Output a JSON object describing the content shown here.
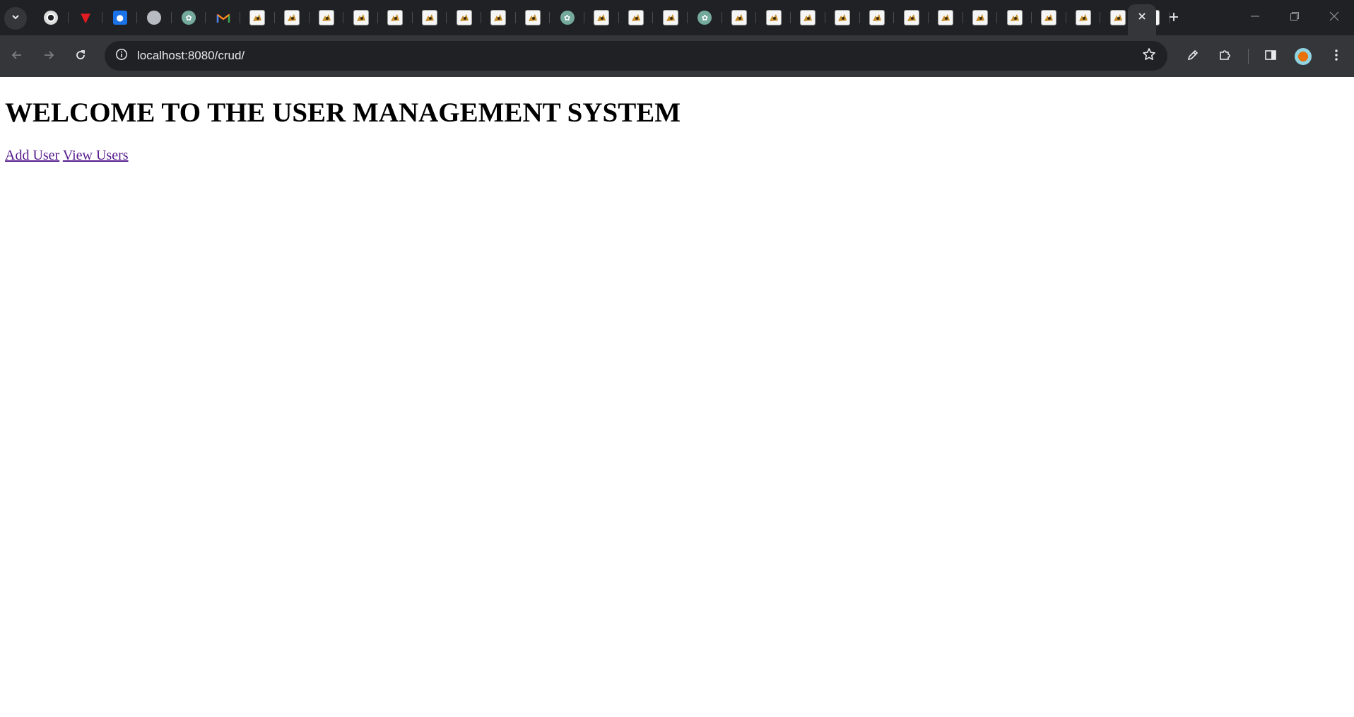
{
  "browser": {
    "tabs": [
      {
        "icon": "chrome-icon"
      },
      {
        "icon": "v-logo-icon"
      },
      {
        "icon": "contacts-icon"
      },
      {
        "icon": "globe-icon"
      },
      {
        "icon": "chatgpt-icon"
      },
      {
        "icon": "gmail-icon"
      },
      {
        "icon": "cat-sticker-icon"
      },
      {
        "icon": "cat-sticker-icon"
      },
      {
        "icon": "cat-sticker-icon"
      },
      {
        "icon": "cat-sticker-icon"
      },
      {
        "icon": "cat-sticker-icon"
      },
      {
        "icon": "cat-sticker-icon"
      },
      {
        "icon": "cat-sticker-icon"
      },
      {
        "icon": "cat-sticker-icon"
      },
      {
        "icon": "cat-sticker-icon"
      },
      {
        "icon": "chatgpt-icon"
      },
      {
        "icon": "cat-sticker-icon"
      },
      {
        "icon": "cat-sticker-icon"
      },
      {
        "icon": "cat-sticker-icon"
      },
      {
        "icon": "chatgpt-icon"
      },
      {
        "icon": "cat-sticker-icon"
      },
      {
        "icon": "cat-sticker-icon"
      },
      {
        "icon": "cat-sticker-icon"
      },
      {
        "icon": "cat-sticker-icon"
      },
      {
        "icon": "cat-sticker-icon"
      },
      {
        "icon": "cat-sticker-icon"
      },
      {
        "icon": "cat-sticker-icon"
      },
      {
        "icon": "cat-sticker-icon"
      },
      {
        "icon": "cat-sticker-icon"
      },
      {
        "icon": "cat-sticker-icon"
      },
      {
        "icon": "cat-sticker-icon"
      },
      {
        "icon": "cat-sticker-icon"
      },
      {
        "icon": "cat-sticker-icon"
      }
    ],
    "address": "localhost:8080/crud/",
    "colors": {
      "frame": "#202124",
      "toolbar": "#35363a",
      "visited_link": "#551a8b"
    }
  },
  "page": {
    "heading": "WELCOME TO THE USER MANAGEMENT SYSTEM",
    "links": {
      "add_user": "Add User",
      "view_users": "View Users"
    }
  }
}
